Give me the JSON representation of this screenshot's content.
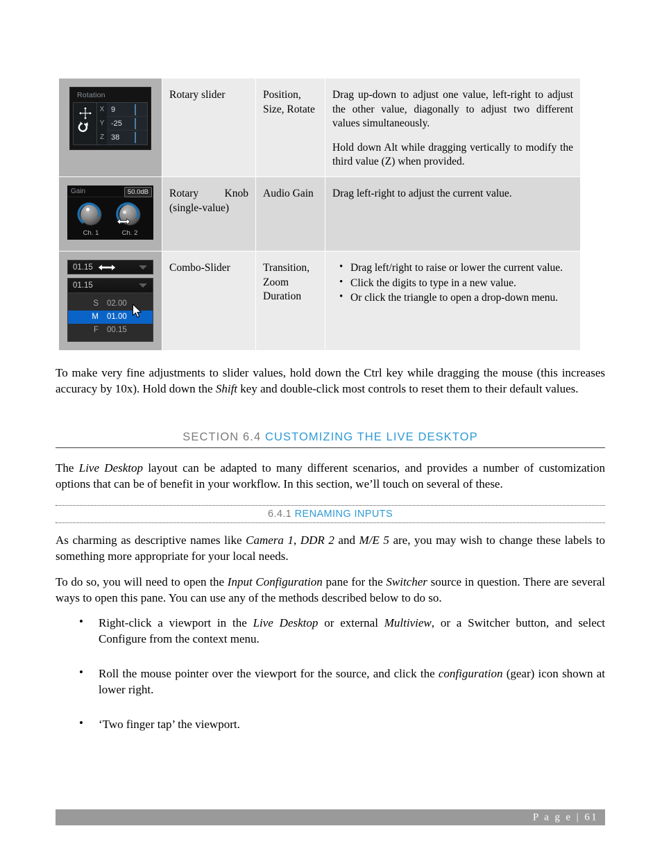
{
  "table": {
    "rows": [
      {
        "widget": {
          "type": "rotation-panel",
          "title": "Rotation",
          "axes": [
            {
              "label": "X",
              "value": "9"
            },
            {
              "label": "Y",
              "value": "-25"
            },
            {
              "label": "Z",
              "value": "38"
            }
          ],
          "icons": [
            "move-cursor-icon",
            "rotate-icon"
          ]
        },
        "control_name": "Rotary slider",
        "typical_use": "Position, Size, Rotate",
        "description_paragraphs": [
          "Drag up-down to adjust one value, left-right to adjust the other value, diagonally to adjust two different values simultaneously.",
          "Hold down Alt while dragging vertically to modify the third value (Z) when provided."
        ],
        "description_bullets": []
      },
      {
        "widget": {
          "type": "gain-panel",
          "title": "Gain",
          "tooltip": "50.0dB",
          "knobs": [
            {
              "label": "Ch. 1"
            },
            {
              "label": "Ch. 2"
            }
          ],
          "icons": [
            "left-right-arrow-cursor-icon"
          ]
        },
        "control_name": "Rotary Knob (single-value)",
        "typical_use": "Audio Gain",
        "description_paragraphs": [
          "Drag left-right to adjust the current value."
        ],
        "description_bullets": []
      },
      {
        "widget": {
          "type": "combo-slider",
          "slider_value": "01.15",
          "field_value": "01.15",
          "dropdown_options": [
            {
              "key": "S",
              "value": "02.00",
              "selected": false
            },
            {
              "key": "M",
              "value": "01.00",
              "selected": true
            },
            {
              "key": "F",
              "value": "00.15",
              "selected": false
            }
          ],
          "icons": [
            "left-right-arrow-icon",
            "triangle-down-icon",
            "mouse-pointer-icon"
          ]
        },
        "control_name": "Combo-Slider",
        "typical_use": "Transition, Zoom Duration",
        "description_paragraphs": [],
        "description_bullets": [
          "Drag left/right to raise or lower the current value.",
          "Click the digits to type in a new value.",
          "Or click the triangle to open a drop-down menu."
        ]
      }
    ]
  },
  "paragraphs": {
    "fine_adjust_part1": "To make very fine adjustments to slider values, hold down the Ctrl key while dragging the mouse (this increases accuracy by 10x). Hold down the ",
    "fine_adjust_shift": "Shift",
    "fine_adjust_part2": " key and double-click most controls to reset them to their default values."
  },
  "section": {
    "number": "SECTION 6.4",
    "title": "CUSTOMIZING THE LIVE DESKTOP",
    "intro_part1": "The ",
    "intro_em1": "Live Desktop",
    "intro_part2": " layout can be adapted to many different scenarios, and provides a number of customization options that can be of benefit in your workflow.  In this section, we’ll touch on several of these."
  },
  "subsection": {
    "number": "6.4.1",
    "title": "RENAMING INPUTS",
    "p1_part1": "As charming as descriptive names like ",
    "p1_em1": "Camera 1",
    "p1_part2": ", ",
    "p1_em2": "DDR 2",
    "p1_part3": " and ",
    "p1_em3": "M/E 5",
    "p1_part4": " are, you may wish to change these labels to something more appropriate for your local needs.",
    "p2_part1": "To do so, you will need to open the ",
    "p2_em1": "Input Configuration",
    "p2_part2": " pane for the ",
    "p2_em2": "Switcher",
    "p2_part3": " source in question.  There are several ways to open this pane.  You can use any of the methods described below to do so.",
    "bullets": [
      {
        "part1": "Right-click a viewport in the ",
        "em1": "Live Desktop",
        "part2": " or external ",
        "em2": "Multiview",
        "part3": ", or a Switcher button, and select Configure from the context menu."
      },
      {
        "part1": "Roll the mouse pointer over the viewport for the source, and click the ",
        "em1": "configuration",
        "part2": " (gear) icon shown at lower right.",
        "em2": "",
        "part3": ""
      },
      {
        "part1": "‘Two finger tap’ the viewport.",
        "em1": "",
        "part2": "",
        "em2": "",
        "part3": ""
      }
    ]
  },
  "footer": {
    "page_label": "P a g e  | 61"
  },
  "colors": {
    "accent_blue": "#2e9ad6",
    "heading_gray": "#7b7b7b",
    "footer_bar": "#9a9a9a",
    "row_light": "#ebebeb",
    "row_dark": "#d9d9d9",
    "widget_col": "#b2b2b2",
    "selection_blue": "#0a64c8"
  }
}
